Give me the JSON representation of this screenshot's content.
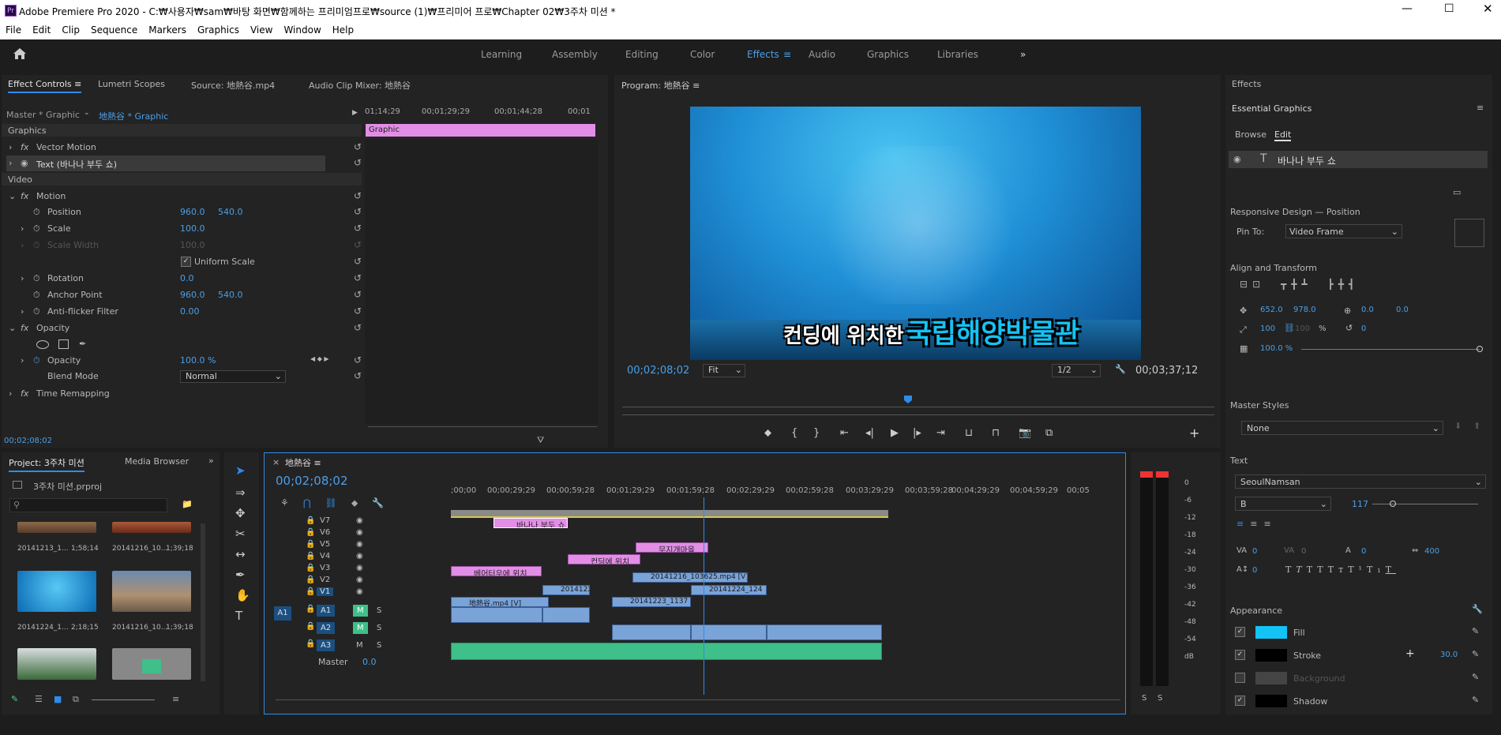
{
  "app": {
    "title": "Adobe Premiere Pro 2020 - C:₩사용자₩sam₩바탕 화면₩함께하는 프리미엄프로₩source (1)₩프리미어 프로₩Chapter 02₩3주차 미션 *",
    "logo": "Pr"
  },
  "menu": [
    "File",
    "Edit",
    "Clip",
    "Sequence",
    "Markers",
    "Graphics",
    "View",
    "Window",
    "Help"
  ],
  "workspaces": [
    "Learning",
    "Assembly",
    "Editing",
    "Color",
    "Effects",
    "Audio",
    "Graphics",
    "Libraries"
  ],
  "active_workspace": "Effects",
  "effect_controls": {
    "tabs": [
      "Effect Controls",
      "Lumetri Scopes",
      "Source: 地熱谷.mp4",
      "Audio Clip Mixer: 地熱谷"
    ],
    "master_label": "Master * Graphic",
    "seq_label": "地熱谷 * Graphic",
    "ruler": [
      "01;14;29",
      "00;01;29;29",
      "00;01;44;28",
      "00;01"
    ],
    "graphic_clip": "Graphic",
    "section_graphics": "Graphics",
    "vector_motion": "Vector Motion",
    "text_layer": "Text (바나나 부두 쇼)",
    "section_video": "Video",
    "motion": "Motion",
    "position_label": "Position",
    "position_x": "960.0",
    "position_y": "540.0",
    "scale_label": "Scale",
    "scale_value": "100.0",
    "scale_width_label": "Scale Width",
    "scale_width_value": "100.0",
    "uniform_scale": "Uniform Scale",
    "rotation_label": "Rotation",
    "rotation_value": "0.0",
    "anchor_label": "Anchor Point",
    "anchor_x": "960.0",
    "anchor_y": "540.0",
    "antiflicker_label": "Anti-flicker Filter",
    "antiflicker_value": "0.00",
    "opacity_section": "Opacity",
    "opacity_label": "Opacity",
    "opacity_value": "100.0 %",
    "blend_label": "Blend Mode",
    "blend_value": "Normal",
    "time_remap": "Time Remapping",
    "timecode": "00;02;08;02"
  },
  "program": {
    "title": "Program: 地熱谷",
    "subtitle_plain": "컨딩에 위치한",
    "subtitle_highlight": "국립해양박물관",
    "timecode": "00;02;08;02",
    "fit": "Fit",
    "resolution": "1/2",
    "duration": "00;03;37;12"
  },
  "project": {
    "tabs": [
      "Project: 3주차 미션",
      "Media Browser"
    ],
    "file": "3주차 미션.prproj",
    "items": [
      {
        "name": "20141213_1...",
        "dur": "1;58;14"
      },
      {
        "name": "20141216_10...",
        "dur": "1;39;18"
      },
      {
        "name": "20141224_1...",
        "dur": "2;18;15"
      },
      {
        "name": "20141216_10...",
        "dur": "1;39;18"
      }
    ]
  },
  "timeline": {
    "seq": "地熱谷",
    "timecode": "00;02;08;02",
    "ruler": [
      ";00;00",
      "00;00;29;29",
      "00;00;59;28",
      "00;01;29;29",
      "00;01;59;28",
      "00;02;29;29",
      "00;02;59;28",
      "00;03;29;29",
      "00;03;59;28",
      "00;04;29;29",
      "00;04;59;29",
      "00;05"
    ],
    "video_tracks": [
      "V7",
      "V6",
      "V5",
      "V4",
      "V3",
      "V2",
      "V1"
    ],
    "audio_tracks": [
      "A1",
      "A2",
      "A3"
    ],
    "src_audio": "A1",
    "master_label": "Master",
    "master_value": "0.0",
    "clips": {
      "v7": "바나나 부두 쇼",
      "v6": "무지개마을",
      "v5": "컨딩에 위치",
      "v4": "베어터우에 위치",
      "v3": "20141216_103625.mp4 [V]",
      "v2a": "20141223",
      "v2b": "20141224_124",
      "v1a": "地熱谷.mp4 [V]",
      "v1b": "20141223_1137"
    }
  },
  "meter": {
    "labels": [
      "0",
      "-6",
      "-12",
      "-18",
      "-24",
      "-30",
      "-36",
      "-42",
      "-48",
      "-54",
      "dB"
    ]
  },
  "essential": {
    "effects_tab": "Effects",
    "title": "Essential Graphics",
    "tabs": [
      "Browse",
      "Edit"
    ],
    "layer": "바나나 부두 쇼",
    "responsive": "Responsive Design — Position",
    "pin_to": "Pin To:",
    "pin_value": "Video Frame",
    "align": "Align and Transform",
    "pos_x": "652.0",
    "pos_y": "978.0",
    "anchor_x": "0.0",
    "anchor_y": "0.0",
    "scale": "100",
    "scale2": "100",
    "pct": "%",
    "rotation": "0",
    "opacity": "100.0 %",
    "master_styles": "Master Styles",
    "style_value": "None",
    "text": "Text",
    "font": "SeoulNamsan",
    "weight": "B",
    "size": "117",
    "kern": "0",
    "track": "0",
    "leading": "0",
    "tsume": "400",
    "baseline": "0",
    "appearance": "Appearance",
    "fill": "Fill",
    "stroke": "Stroke",
    "stroke_width": "30.0",
    "background": "Background",
    "shadow": "Shadow",
    "colors": {
      "fill": "#14c3f5",
      "stroke": "#000000"
    }
  }
}
